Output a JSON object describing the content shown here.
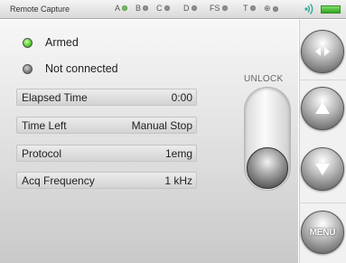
{
  "titlebar": {
    "app_title": "Remote Capture",
    "channels": [
      {
        "label": "A",
        "active": true
      },
      {
        "label": "B",
        "active": false
      },
      {
        "label": "C",
        "active": false
      },
      {
        "label": "D",
        "active": false
      },
      {
        "label": "FS",
        "active": false
      },
      {
        "label": "T",
        "active": false
      },
      {
        "label": "⊕",
        "active": false
      }
    ],
    "signal_icon": "wireless-signal-icon",
    "battery_icon": "battery-icon"
  },
  "status": {
    "armed_label": "Armed",
    "connection_label": "Not connected"
  },
  "fields": [
    {
      "label": "Elapsed Time",
      "value": "0:00"
    },
    {
      "label": "Time Left",
      "value": "Manual Stop"
    },
    {
      "label": "Protocol",
      "value": "1emg"
    },
    {
      "label": "Acq Frequency",
      "value": "1 kHz"
    }
  ],
  "slider": {
    "label": "UNLOCK"
  },
  "buttons": {
    "swap_icon": "swap-arrows-icon",
    "up_icon": "arrow-up-icon",
    "down_icon": "arrow-down-icon",
    "menu_label": "MENU"
  },
  "colors": {
    "armed": "#3fbf1f",
    "disconnected": "#707070",
    "battery": "#2fa321"
  }
}
